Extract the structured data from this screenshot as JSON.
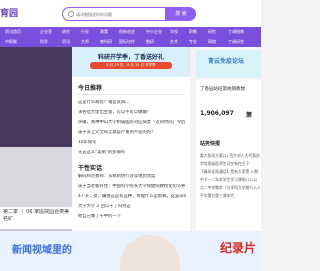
{
  "header": {
    "logo_text": "育园",
    "search_placeholder": "请详细描述你的问题",
    "search_button": "搜 索"
  },
  "nav": {
    "row1": [
      "资讯首页",
      "企业宣",
      "研究",
      "行业",
      "政策",
      "创新创业",
      "中小企业",
      "学校",
      "职教",
      "研究",
      "丁调指南"
    ],
    "row2": [
      "中职联",
      "科学",
      "资讯",
      "大师",
      "教科研",
      "国际协作",
      "教研",
      "艺术",
      "专业",
      "网络",
      "丁调研究"
    ]
  },
  "banner": {
    "title": "科研开学季，丁香送好礼",
    "subtitle": "8 月 29 日—9 月 30 日 开学季"
  },
  "left": {
    "caption_lines": [
      "第二季 丨 06 家医院园合类美轮",
      "名矿"
    ]
  },
  "center": {
    "today_title": "今日推荐",
    "today_items": [
      "这是什么病症？诸是其病...",
      "求各位大佬出主意，可以不可以做做？",
      "突破，两种中山大学附属医院对应病女「近同时间」今后",
      "孩子没上完全和无意是严重到不是的吗？",
      "10年保论",
      "先这这么\"美丽\"的多弱吗"
    ],
    "hot_title": "干性实话",
    "hot_items": [
      "解码师范教师：从机制创行过谈地到文度",
      "孩子当老板好住：中国科学院长大学保健院教授化何么养",
      "47 岁，女，嫌患这是有这种，奇能什么是新病，这是非论",
      "大学大学 2 回以干了吗到这",
      "给自己做了干中的一下",
      "给自己做了干中的一下"
    ]
  },
  "right": {
    "ad_text": "青云免疫论坛",
    "box_title": "丁香园站班第纳期教数",
    "stat1_value": "1,906,097",
    "stat1_label": "",
    "stat2_value": "第",
    "stat2_label": "",
    "section_title": "站务快报",
    "section_lines": [
      "重大医改方案(1) 百方对人大代表选主",
      "学信息级医师生证交有在主下",
      "【春风化雨通话】是有大家第 3 期",
      "中子一二年本学生学习课指(11)以",
      "点二中学教学（与学科大学推行入入",
      "平学第方第三课本代"
    ]
  },
  "bottom": {
    "text_blue": "新闻视域里的",
    "text_red": "纪录片"
  }
}
